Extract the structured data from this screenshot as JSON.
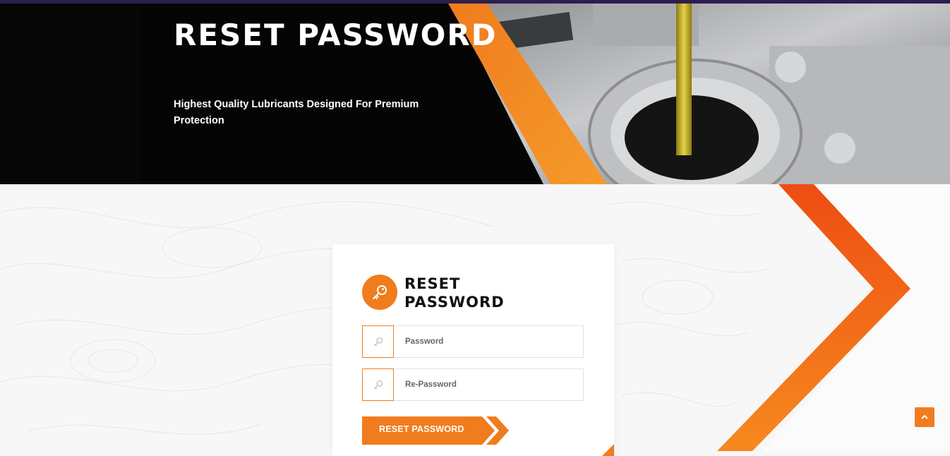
{
  "hero": {
    "title": "RESET PASSWORD",
    "subtitle": "Highest Quality Lubricants Designed For Premium Protection"
  },
  "form": {
    "title": "RESET PASSWORD",
    "password_placeholder": "Password",
    "repassword_placeholder": "Re-Password",
    "submit_label": "RESET PASSWORD"
  },
  "icons": {
    "form_icon": "key-icon",
    "field_icon": "key-icon",
    "back_to_top": "chevron-up-icon"
  },
  "colors": {
    "accent": "#f07c1e",
    "accent_red": "#ee4d12",
    "hero_bg": "#050505",
    "top_line": "#2d1f4e",
    "page_bg": "#f7f7f7"
  }
}
